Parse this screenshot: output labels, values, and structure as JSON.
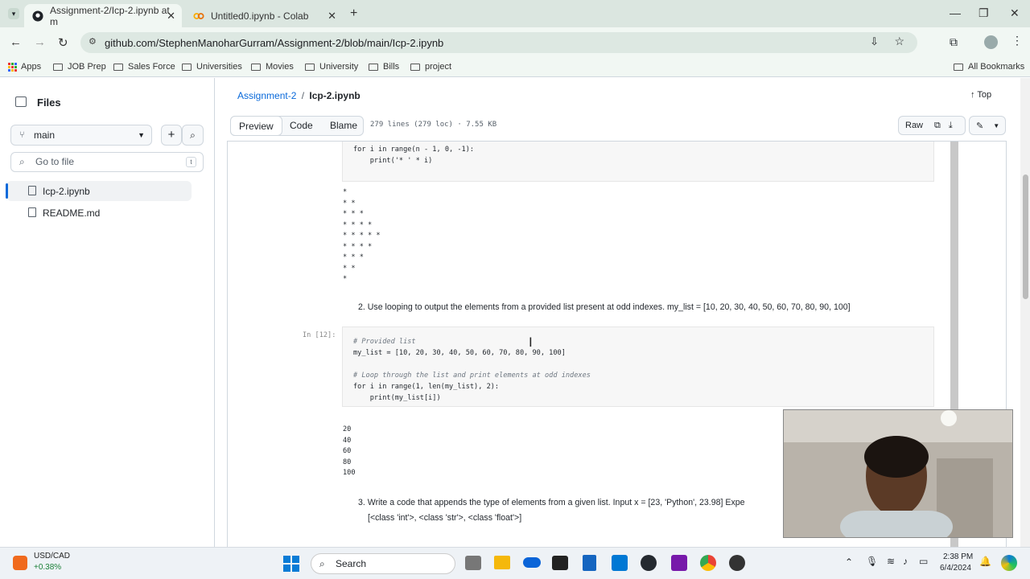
{
  "browser": {
    "tabs": [
      {
        "title": "Assignment-2/Icp-2.ipynb at m"
      },
      {
        "title": "Untitled0.ipynb - Colab"
      }
    ],
    "url": "github.com/StephenManoharGurram/Assignment-2/blob/main/Icp-2.ipynb",
    "bookmarks": [
      "Apps",
      "JOB Prep",
      "Sales Force",
      "Universities",
      "Movies",
      "University",
      "Bills",
      "project"
    ],
    "all_bookmarks": "All Bookmarks"
  },
  "sidebar": {
    "title": "Files",
    "branch": "main",
    "search_placeholder": "Go to file",
    "search_shortcut": "t",
    "files": [
      "Icp-2.ipynb",
      "README.md"
    ]
  },
  "header": {
    "repo": "Assignment-2",
    "separator": "/",
    "file": "Icp-2.ipynb",
    "top": "Top"
  },
  "toolbar": {
    "tabs": [
      "Preview",
      "Code",
      "Blame"
    ],
    "meta": "279 lines (279 loc) · 7.55 KB",
    "raw": "Raw"
  },
  "notebook": {
    "cell0_code": "for i in range(n - 1, 0, -1):\n    print('* ' * i)",
    "pattern_output": "*\n* *\n* * *\n* * * *\n* * * * *\n* * * *\n* * *\n* *\n*",
    "q2": "2. Use looping to output the elements from a provided list present at odd indexes. my_list = [10, 20, 30, 40, 50, 60, 70, 80, 90, 100]",
    "prompt": "In [12]:",
    "c1": "# Provided list",
    "c2": "my_list = [10, 20, 30, 40, 50, 60, 70, 80, 90, 100]",
    "c3": "# Loop through the list and print elements at odd indexes",
    "c4": "for i in range(1, len(my_list), 2):",
    "c5": "    print(my_list[i])",
    "odd_output": "20\n40\n60\n80\n100",
    "q3_line1": "3. Write a code that appends the type of elements from a given list. Input x = [23, 'Python', 23.98] Expe",
    "q3_line2": "[<class 'int'>, <class 'str'>, <class 'float'>]"
  },
  "taskbar": {
    "ticker": "USD/CAD",
    "ticker_change": "+0.38%",
    "search": "Search",
    "time": "2:38 PM",
    "date": "6/4/2024"
  }
}
